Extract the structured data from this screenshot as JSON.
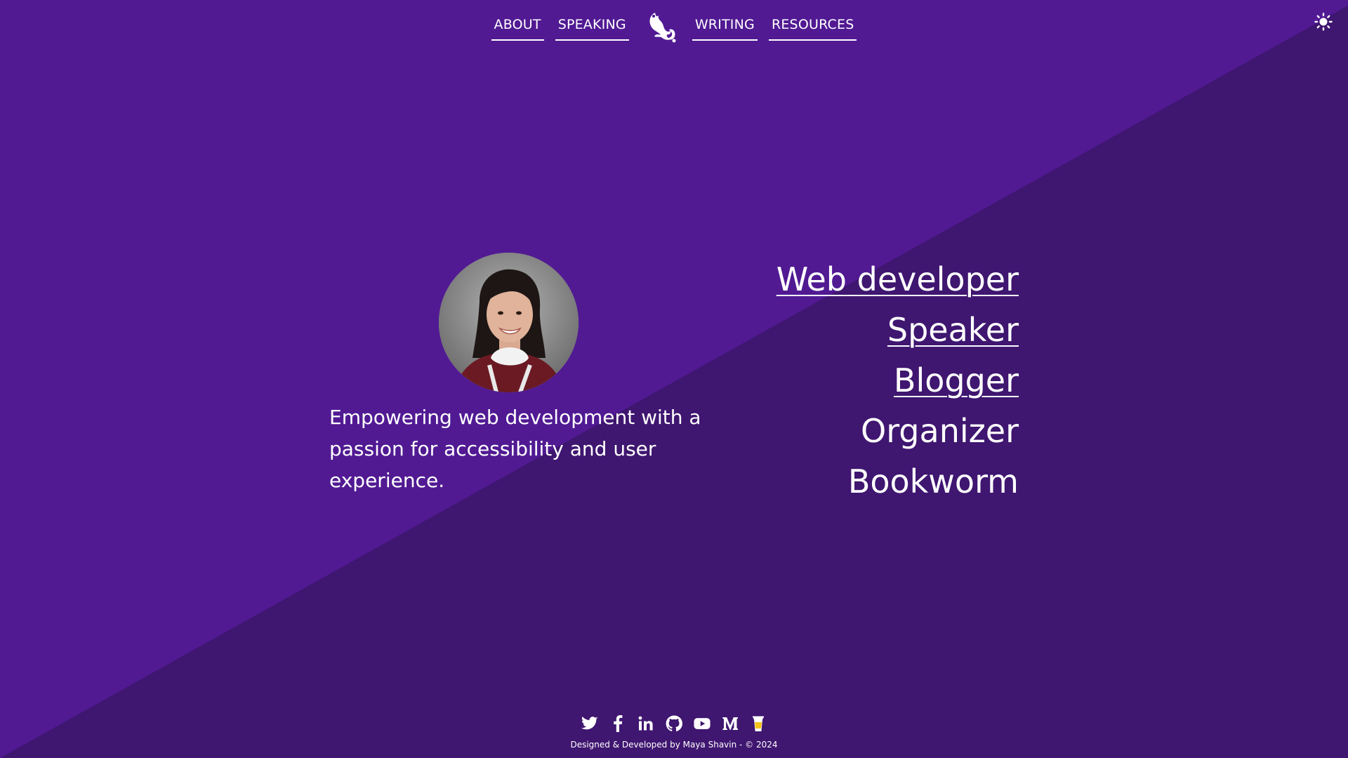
{
  "colors": {
    "background_upper": "#511a93",
    "background_lower": "#3f1670",
    "text": "#ffffff"
  },
  "nav": {
    "links": [
      {
        "label": "ABOUT"
      },
      {
        "label": "SPEAKING"
      },
      {
        "label": "WRITING"
      },
      {
        "label": "RESOURCES"
      }
    ],
    "logo_icon": "squirrel-logo-icon",
    "theme_toggle_icon": "sun-icon"
  },
  "hero": {
    "avatar_icon": "profile-photo",
    "tagline": "Empowering web development with a passion for accessibility and user experience.",
    "roles": [
      {
        "label": "Web developer",
        "is_link": true
      },
      {
        "label": "Speaker",
        "is_link": true
      },
      {
        "label": "Blogger",
        "is_link": true
      },
      {
        "label": "Organizer",
        "is_link": false
      },
      {
        "label": "Bookworm",
        "is_link": false
      }
    ]
  },
  "footer": {
    "socials": [
      {
        "icon": "twitter-icon"
      },
      {
        "icon": "facebook-icon"
      },
      {
        "icon": "linkedin-icon"
      },
      {
        "icon": "github-icon"
      },
      {
        "icon": "youtube-icon"
      },
      {
        "icon": "medium-icon"
      },
      {
        "icon": "coffee-cup-icon"
      }
    ],
    "credit": "Designed & Developed by Maya Shavin - © 2024"
  }
}
